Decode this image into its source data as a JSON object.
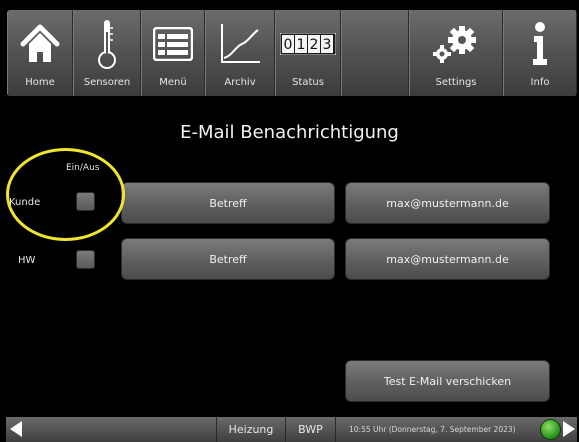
{
  "nav": {
    "home": {
      "label": "Home",
      "icon": "home-icon"
    },
    "sensors": {
      "label": "Sensoren",
      "icon": "thermometer-icon"
    },
    "menu": {
      "label": "Menü",
      "icon": "menu-list-icon"
    },
    "archive": {
      "label": "Archiv",
      "icon": "chart-line-icon"
    },
    "status": {
      "label": "Status",
      "icon": "counter-icon",
      "digits": [
        "0",
        "1",
        "2",
        "3"
      ]
    },
    "settings": {
      "label": "Settings",
      "icon": "gears-icon"
    },
    "info": {
      "label": "Info",
      "icon": "info-icon"
    }
  },
  "main": {
    "title": "E-Mail Benachrichtigung",
    "column_header": "Ein/Aus",
    "rows": [
      {
        "label": "Kunde",
        "subject_button": "Betreff",
        "email": "max@mustermann.de",
        "enabled": false
      },
      {
        "label": "HW",
        "subject_button": "Betreff",
        "email": "max@mustermann.de",
        "enabled": false
      }
    ],
    "test_button": "Test E-Mail verschicken"
  },
  "statusbar": {
    "heating": "Heizung",
    "bwp": "BWP",
    "datetime": "10:55 Uhr (Donnerstag, 7. September 2023)",
    "globe_icon": "globe-icon"
  },
  "colors": {
    "highlight": "#f0e52e",
    "background": "#000000",
    "button": "#616161"
  }
}
